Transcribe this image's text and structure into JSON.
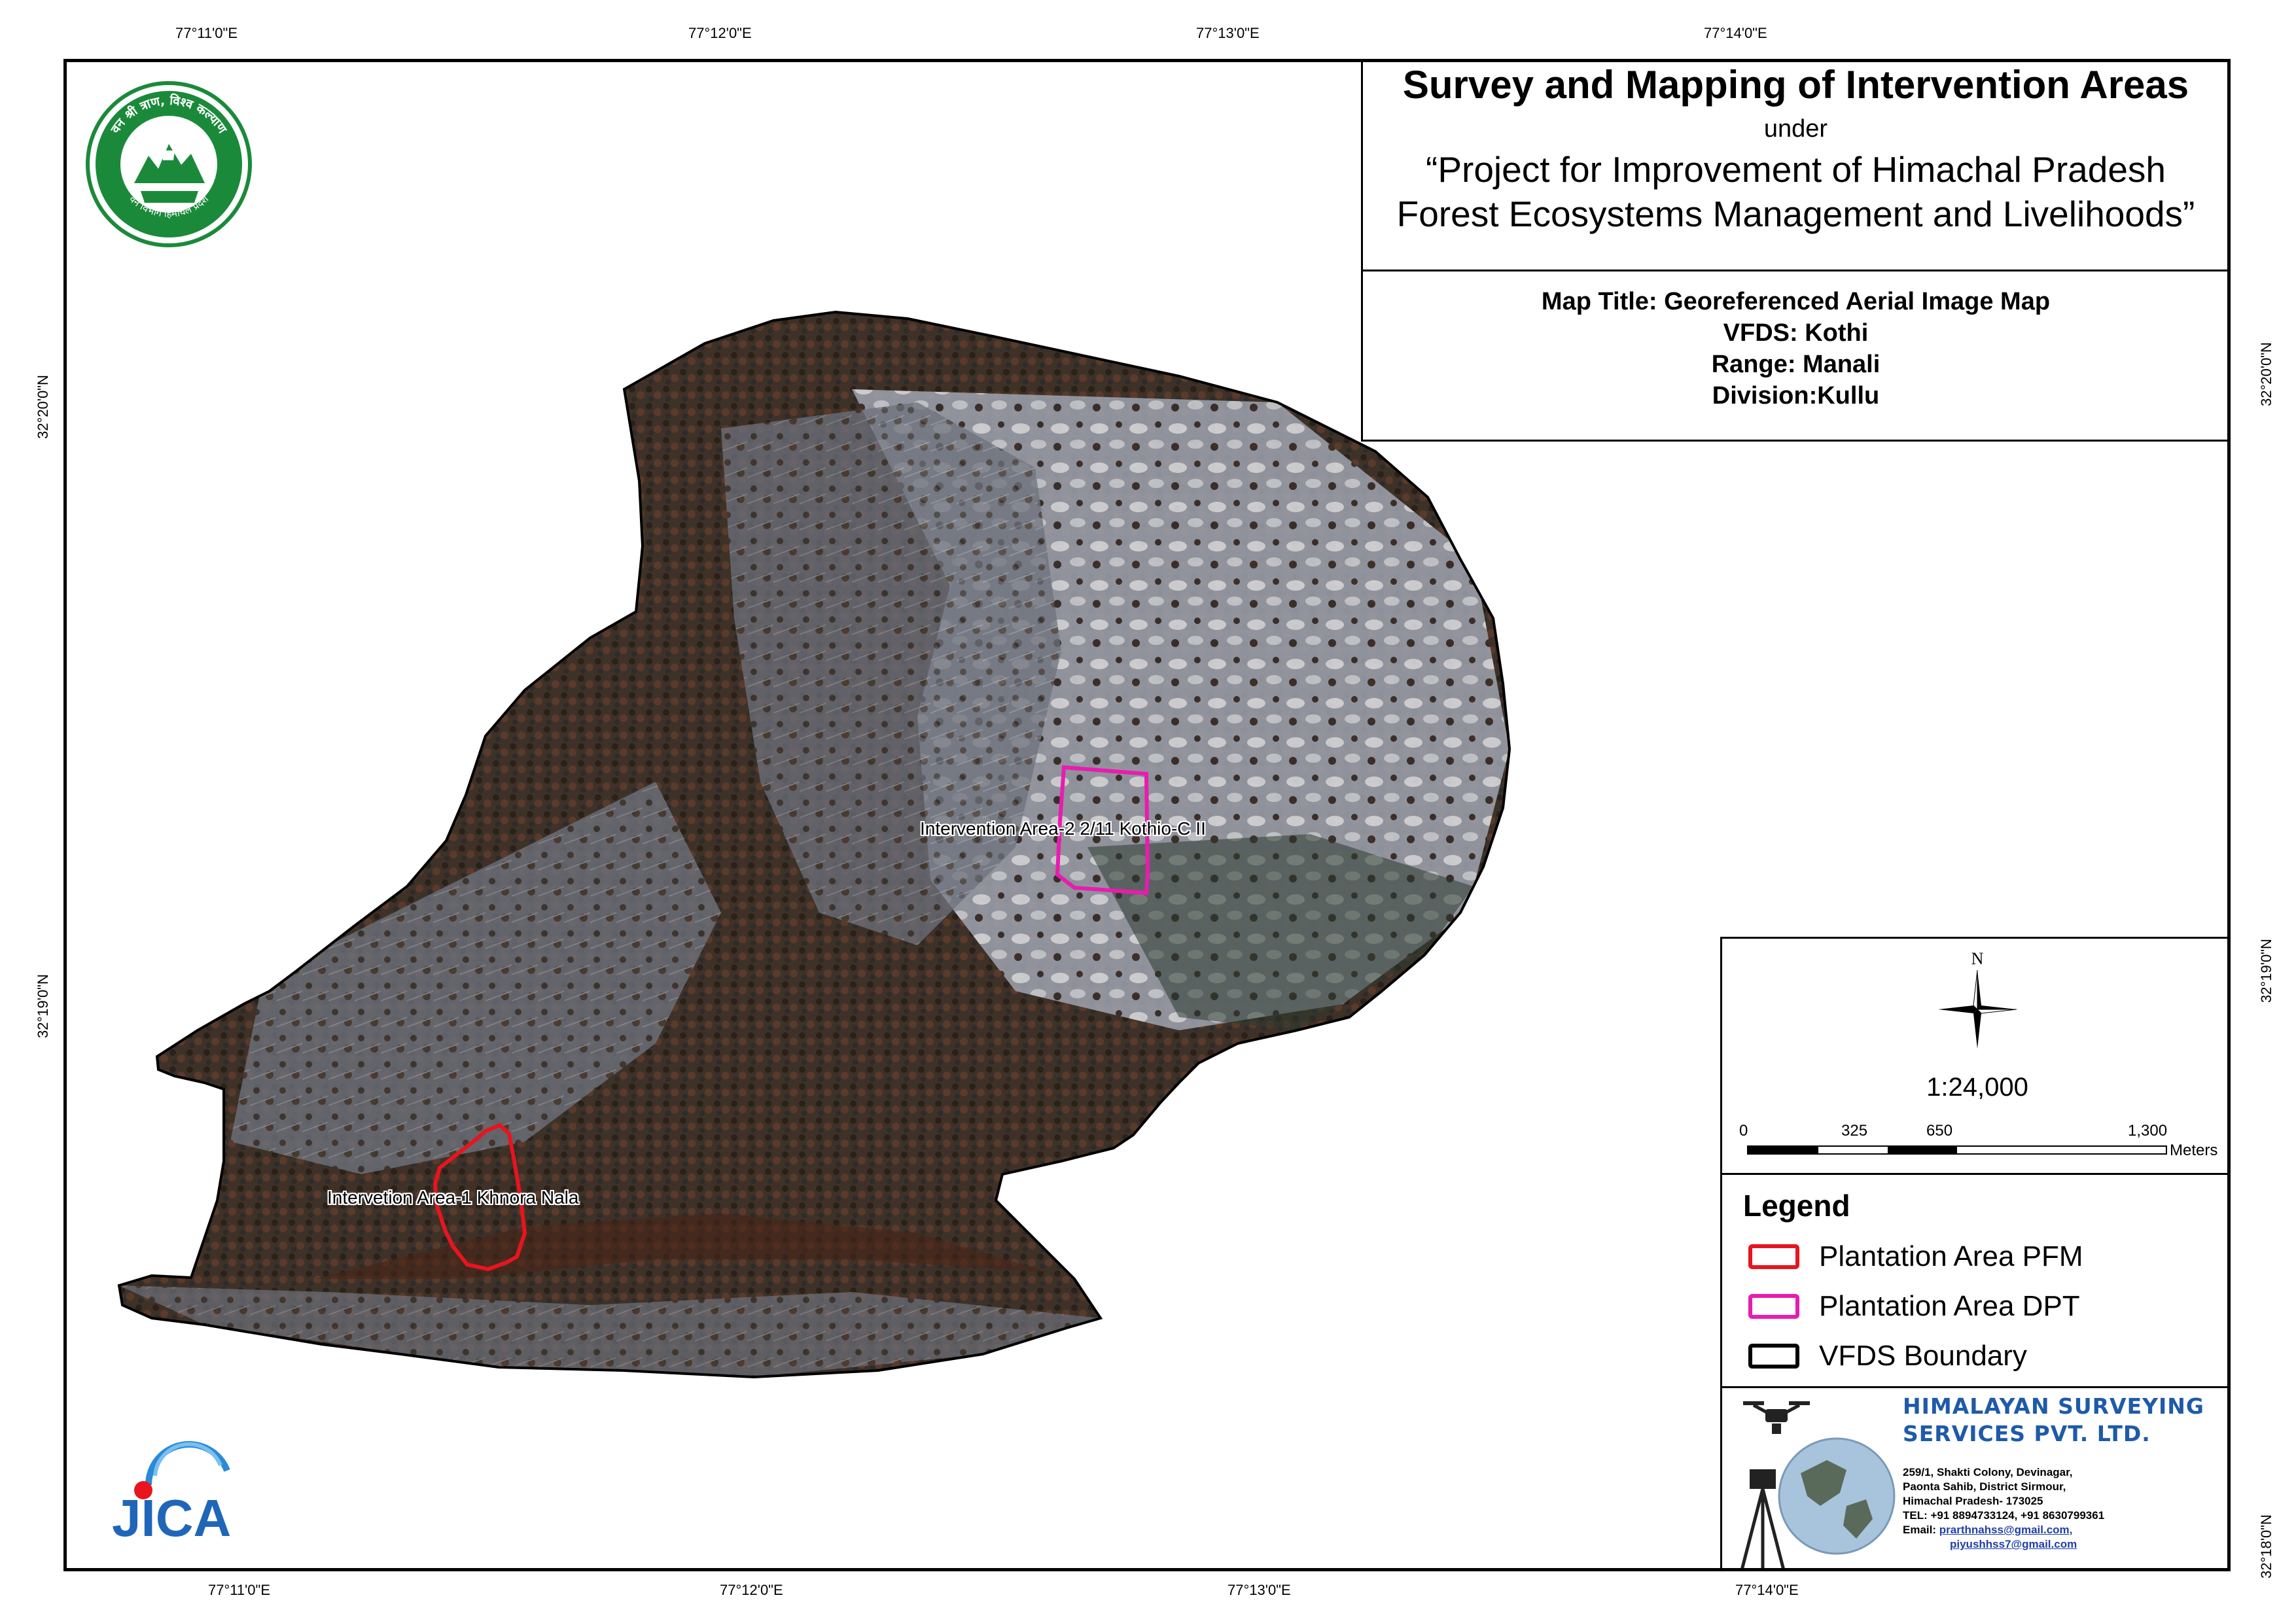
{
  "graticule": {
    "top": [
      "77°11'0\"E",
      "77°12'0\"E",
      "77°13'0\"E",
      "77°14'0\"E"
    ],
    "bottom": [
      "77°11'0\"E",
      "77°12'0\"E",
      "77°13'0\"E",
      "77°14'0\"E"
    ],
    "left": [
      "32°20'0\"N",
      "32°19'0\"N"
    ],
    "right": [
      "32°20'0\"N",
      "32°19'0\"N",
      "32°18'0\"N"
    ]
  },
  "title_panel": {
    "title": "Survey and Mapping of Intervention Areas",
    "under": "under",
    "project_line1": "“Project for Improvement of Himachal Pradesh",
    "project_line2": "Forest Ecosystems Management and Livelihoods”"
  },
  "info_panel": {
    "map_title": "Map Title: Georeferenced Aerial Image Map",
    "vfds": "VFDS: Kothi",
    "range": "Range: Manali",
    "division": "Division:Kullu"
  },
  "scale_panel": {
    "north": "N",
    "scale": "1:24,000",
    "ticks": [
      "0",
      "325",
      "650",
      "1,300"
    ],
    "units": "Meters"
  },
  "legend": {
    "title": "Legend",
    "items": [
      {
        "label": "Plantation Area PFM",
        "color": "#e8141e"
      },
      {
        "label": "Plantation Area DPT",
        "color": "#e81cb0"
      },
      {
        "label": "VFDS Boundary",
        "color": "#000000"
      }
    ]
  },
  "map_labels": {
    "area1": "Intervetion Area-1 Khnora Nala",
    "area2": "Intervention Area-2 2/11 Kothio-C II"
  },
  "logos": {
    "forest_seal_text_top": "वन श्री त्राण, विश्व कल्याण",
    "forest_seal_text_bottom": "वन विभाग हिमाचल प्रदेश",
    "jica": "JICA"
  },
  "company": {
    "name_line1": "HIMALAYAN SURVEYING",
    "name_line2": "SERVICES PVT. LTD.",
    "address1": "259/1, Shakti Colony, Devinagar,",
    "address2": "Paonta Sahib, District Sirmour,",
    "address3": "Himachal Pradesh- 173025",
    "tel": "TEL: +91 8894733124, +91 8630799361",
    "email_label": "Email:",
    "email1": "prarthnahss@gmail.com,",
    "email2": "piyushhss7@gmail.com"
  }
}
